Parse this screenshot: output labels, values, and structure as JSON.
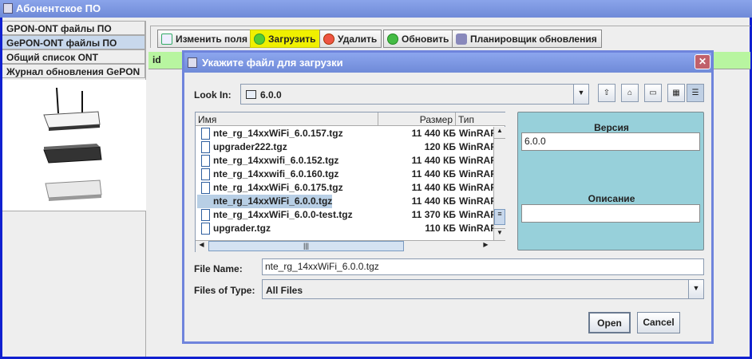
{
  "app": {
    "title": "Абонентское ПО"
  },
  "sidebar": {
    "items": [
      {
        "label": "GPON-ONT файлы ПО"
      },
      {
        "label": "GePON-ONT файлы ПО",
        "selected": true
      },
      {
        "label": "Общий список ONT"
      },
      {
        "label": "Журнал обновления GePON"
      }
    ]
  },
  "toolbar": {
    "edit_label": "Изменить поля",
    "upload_label": "Загрузить",
    "delete_label": "Удалить",
    "refresh_label": "Обновить",
    "scheduler_label": "Планировщик обновления"
  },
  "table": {
    "columns": [
      "id"
    ]
  },
  "dialog": {
    "title": "Укажите файл для загрузки",
    "look_in_label": "Look In:",
    "look_in_value": "6.0.0",
    "columns": {
      "name": "Имя",
      "size": "Размер",
      "type": "Тип"
    },
    "files": [
      {
        "name": "nte_rg_14xxWiFi_6.0.157.tgz",
        "size": "11 440 КБ",
        "type": "WinRAR a"
      },
      {
        "name": "upgrader222.tgz",
        "size": "120 КБ",
        "type": "WinRAR a"
      },
      {
        "name": "nte_rg_14xxwifi_6.0.152.tgz",
        "size": "11 440 КБ",
        "type": "WinRAR a"
      },
      {
        "name": "nte_rg_14xxwifi_6.0.160.tgz",
        "size": "11 440 КБ",
        "type": "WinRAR a"
      },
      {
        "name": "nte_rg_14xxWiFi_6.0.175.tgz",
        "size": "11 440 КБ",
        "type": "WinRAR a"
      },
      {
        "name": "nte_rg_14xxWiFi_6.0.0.tgz",
        "size": "11 440 КБ",
        "type": "WinRAR a",
        "selected": true
      },
      {
        "name": "nte_rg_14xxWiFi_6.0.0-test.tgz",
        "size": "11 370 КБ",
        "type": "WinRAR a"
      },
      {
        "name": "upgrader.tgz",
        "size": "110 КБ",
        "type": "WinRAR a"
      }
    ],
    "version_label": "Версия",
    "version_value": "6.0.0",
    "description_label": "Описание",
    "description_value": "",
    "file_name_label": "File Name:",
    "file_name_value": "nte_rg_14xxWiFi_6.0.0.tgz",
    "file_type_label": "Files of Type:",
    "file_type_value": "All Files",
    "open_label": "Open",
    "cancel_label": "Cancel"
  },
  "colors": {
    "highlight": "#f0f000",
    "table_header": "#b8f5a0",
    "panel": "#97d0da",
    "title_bar": "#7a96df"
  }
}
